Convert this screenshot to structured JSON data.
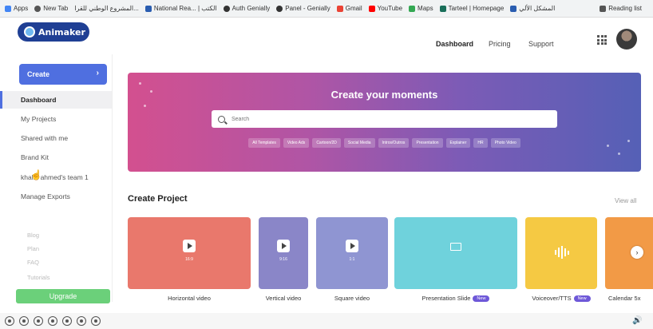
{
  "bookmarks": {
    "items": [
      "Apps",
      "New Tab",
      "المشروع الوطني للقرا...",
      "National Rea... | الكتب",
      "Auth Genially",
      "Panel - Genially",
      "Gmail",
      "YouTube",
      "Maps",
      "Tarteel | Homepage",
      "المشكل الألي"
    ],
    "reading_list": "Reading list"
  },
  "brand": {
    "logo_text": "Animaker"
  },
  "header": {
    "nav": [
      "Dashboard",
      "Pricing",
      "Support"
    ]
  },
  "sidebar": {
    "create_label": "Create",
    "items": [
      "Dashboard",
      "My Projects",
      "Shared with me",
      "Brand Kit",
      "khalid ahmed's team 1",
      "Manage Exports"
    ],
    "faded": [
      "Blog",
      "Plan",
      "FAQ",
      "Tutorials"
    ],
    "upgrade_label": "Upgrade"
  },
  "hero": {
    "title": "Create your moments",
    "search_placeholder": "Search",
    "chips": [
      "All Templates",
      "Video Ads",
      "Cartoon/2D",
      "Social Media",
      "Intros/Outros",
      "Presentation",
      "Explainer",
      "HR",
      "Photo Video"
    ]
  },
  "create_project": {
    "title": "Create Project",
    "view_all": "View all",
    "cards": [
      {
        "label": "Horizontal video",
        "ratio": "16:9",
        "color": "#e9786c",
        "is_new": false
      },
      {
        "label": "Vertical video",
        "ratio": "9:16",
        "color": "#8a86c8",
        "is_new": false
      },
      {
        "label": "Square video",
        "ratio": "1:1",
        "color": "#8f95d2",
        "is_new": false
      },
      {
        "label": "Presentation Slide",
        "ratio": "",
        "color": "#6fd2dc",
        "is_new": true
      },
      {
        "label": "Voiceover/TTS",
        "ratio": "",
        "color": "#f5c943",
        "is_new": true
      },
      {
        "label": "Calendar 5x",
        "ratio": "",
        "color": "#f29a46",
        "is_new": false
      }
    ],
    "new_badge": "New"
  },
  "player": {
    "controls": [
      "rewind",
      "play",
      "pause",
      "stop",
      "forward",
      "record",
      "mute"
    ]
  }
}
